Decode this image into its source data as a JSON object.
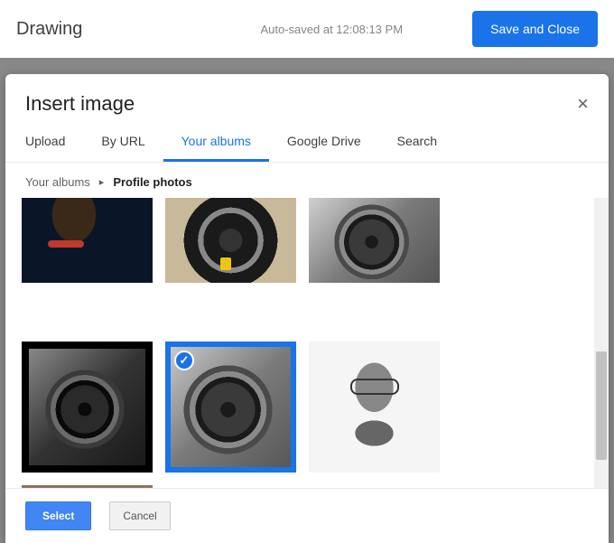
{
  "topbar": {
    "title": "Drawing",
    "autosave": "Auto-saved at 12:08:13 PM",
    "save_button": "Save and Close"
  },
  "modal": {
    "title": "Insert image",
    "tabs": [
      "Upload",
      "By URL",
      "Your albums",
      "Google Drive",
      "Search"
    ],
    "active_tab_index": 2,
    "breadcrumb": {
      "root": "Your albums",
      "current": "Profile photos"
    },
    "footer": {
      "select": "Select",
      "cancel": "Cancel"
    },
    "thumbs": {
      "selected_index": 4
    }
  }
}
